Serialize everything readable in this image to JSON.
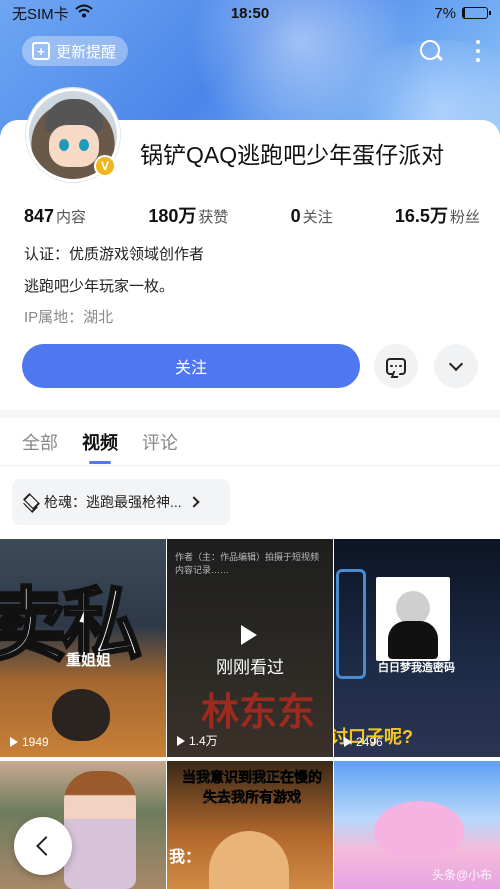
{
  "status_bar": {
    "carrier": "无SIM卡",
    "time": "18:50",
    "battery": "7%",
    "battery_level": 0.07
  },
  "header": {
    "update_label": "更新提醒"
  },
  "profile": {
    "username": "锅铲QAQ逃跑吧少年蛋仔派对",
    "verified_badge": "V",
    "stats": [
      {
        "num": "847",
        "label": "内容"
      },
      {
        "num": "180万",
        "label": "获赞"
      },
      {
        "num": "0",
        "label": "关注"
      },
      {
        "num": "16.5万",
        "label": "粉丝"
      }
    ],
    "certification": "认证：优质游戏领域创作者",
    "bio": "逃跑吧少年玩家一枚。",
    "ip": "IP属地：湖北"
  },
  "actions": {
    "follow_label": "关注"
  },
  "tabs": [
    "全部",
    "视频",
    "评论"
  ],
  "collection": {
    "label": "枪魂：逃跑最强枪神..."
  },
  "videos": [
    {
      "overlay": "卖私",
      "subtitle": "重姐姐",
      "views": "1949"
    },
    {
      "text": "作者（主：作品编辑）拍摄于短视频内容记录……",
      "watched": "刚刚看过",
      "overlay": "林东东",
      "views": "1.4万"
    },
    {
      "caption": "白日梦我造密码",
      "overlay": "讨口子呢?",
      "views": "2496"
    },
    {},
    {
      "overlay": "当我意识到我正在慢的失去我所有游戏",
      "label": "我："
    },
    {
      "watermark": "头条@小布"
    }
  ],
  "colors": {
    "accent": "#4f78f0",
    "badge": "#f2b51f"
  }
}
